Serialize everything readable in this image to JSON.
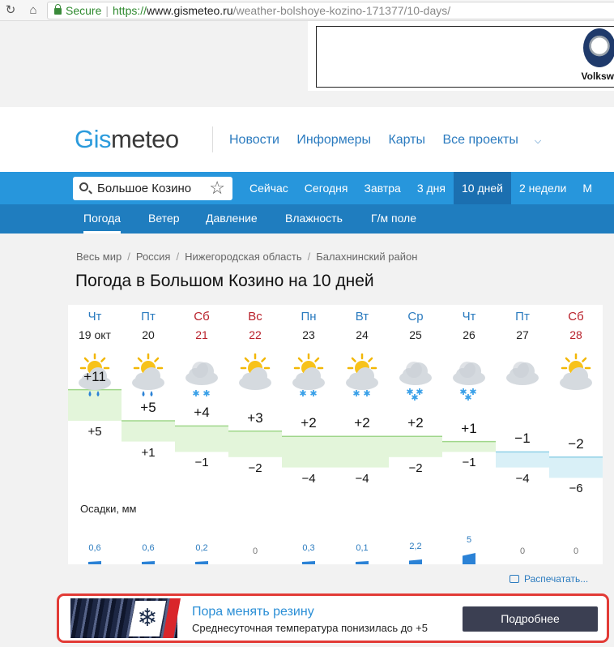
{
  "browser": {
    "secure_label": "Secure",
    "url_scheme": "https://",
    "url_host": "www.gismeteo.ru",
    "url_path": "/weather-bolshoye-kozino-171377/10-days/"
  },
  "top_ad": {
    "brand": "Volksw"
  },
  "header": {
    "logo_part1": "Gis",
    "logo_part2": "meteo",
    "nav": [
      "Новости",
      "Информеры",
      "Карты",
      "Все проекты"
    ]
  },
  "search": {
    "value": "Большое Козино"
  },
  "period_tabs": [
    "Сейчас",
    "Сегодня",
    "Завтра",
    "3 дня",
    "10 дней",
    "2 недели",
    "М"
  ],
  "sub_tabs": [
    "Погода",
    "Ветер",
    "Давление",
    "Влажность",
    "Г/м поле"
  ],
  "breadcrumb": [
    "Весь мир",
    "Россия",
    "Нижегородская область",
    "Балахнинский район"
  ],
  "page_title": "Погода в Большом Козино на 10 дней",
  "forecast": {
    "precip_label": "Осадки, мм",
    "days": [
      {
        "weekday": "Чт",
        "date": "19 окт",
        "weekend": false,
        "icon": "sun-cloud-rain-icon",
        "max": "+11",
        "min": "+5",
        "precip": "0,6",
        "precip_mm": 0.6
      },
      {
        "weekday": "Пт",
        "date": "20",
        "weekend": false,
        "icon": "sun-cloud-rain-icon",
        "max": "+5",
        "min": "+1",
        "precip": "0,6",
        "precip_mm": 0.6
      },
      {
        "weekday": "Сб",
        "date": "21",
        "weekend": true,
        "icon": "cloud-snow-icon",
        "max": "+4",
        "min": "−1",
        "precip": "0,2",
        "precip_mm": 0.2
      },
      {
        "weekday": "Вс",
        "date": "22",
        "weekend": true,
        "icon": "sun-cloud-icon",
        "max": "+3",
        "min": "−2",
        "precip": "0",
        "precip_mm": 0
      },
      {
        "weekday": "Пн",
        "date": "23",
        "weekend": false,
        "icon": "sun-cloud-snow-icon",
        "max": "+2",
        "min": "−4",
        "precip": "0,3",
        "precip_mm": 0.3
      },
      {
        "weekday": "Вт",
        "date": "24",
        "weekend": false,
        "icon": "sun-cloud-snow-icon",
        "max": "+2",
        "min": "−4",
        "precip": "0,1",
        "precip_mm": 0.1
      },
      {
        "weekday": "Ср",
        "date": "25",
        "weekend": false,
        "icon": "cloud-heavy-snow-icon",
        "max": "+2",
        "min": "−2",
        "precip": "2,2",
        "precip_mm": 2.2
      },
      {
        "weekday": "Чт",
        "date": "26",
        "weekend": false,
        "icon": "cloud-heavy-snow-icon",
        "max": "+1",
        "min": "−1",
        "precip": "5",
        "precip_mm": 5
      },
      {
        "weekday": "Пт",
        "date": "27",
        "weekend": false,
        "icon": "cloud-icon",
        "max": "−1",
        "min": "−4",
        "precip": "0",
        "precip_mm": 0
      },
      {
        "weekday": "Сб",
        "date": "28",
        "weekend": true,
        "icon": "sun-cloud-icon",
        "max": "−2",
        "min": "−6",
        "precip": "0",
        "precip_mm": 0
      }
    ],
    "max_values": [
      11,
      5,
      4,
      3,
      2,
      2,
      2,
      1,
      -1,
      -2
    ],
    "min_values": [
      5,
      1,
      -1,
      -2,
      -4,
      -4,
      -2,
      -1,
      -4,
      -6
    ]
  },
  "print_link": "Распечатать...",
  "bottom_ad": {
    "title": "Пора менять резину",
    "subtitle": "Среднесуточная температура понизилась до +5",
    "button": "Подробнее"
  },
  "colors": {
    "brand_blue": "#2796dc",
    "subnav_blue": "#1f7dbf",
    "weekend_red": "#b8202a",
    "warm_band": "#e3f5da",
    "cold_band": "#d9f0f7"
  }
}
